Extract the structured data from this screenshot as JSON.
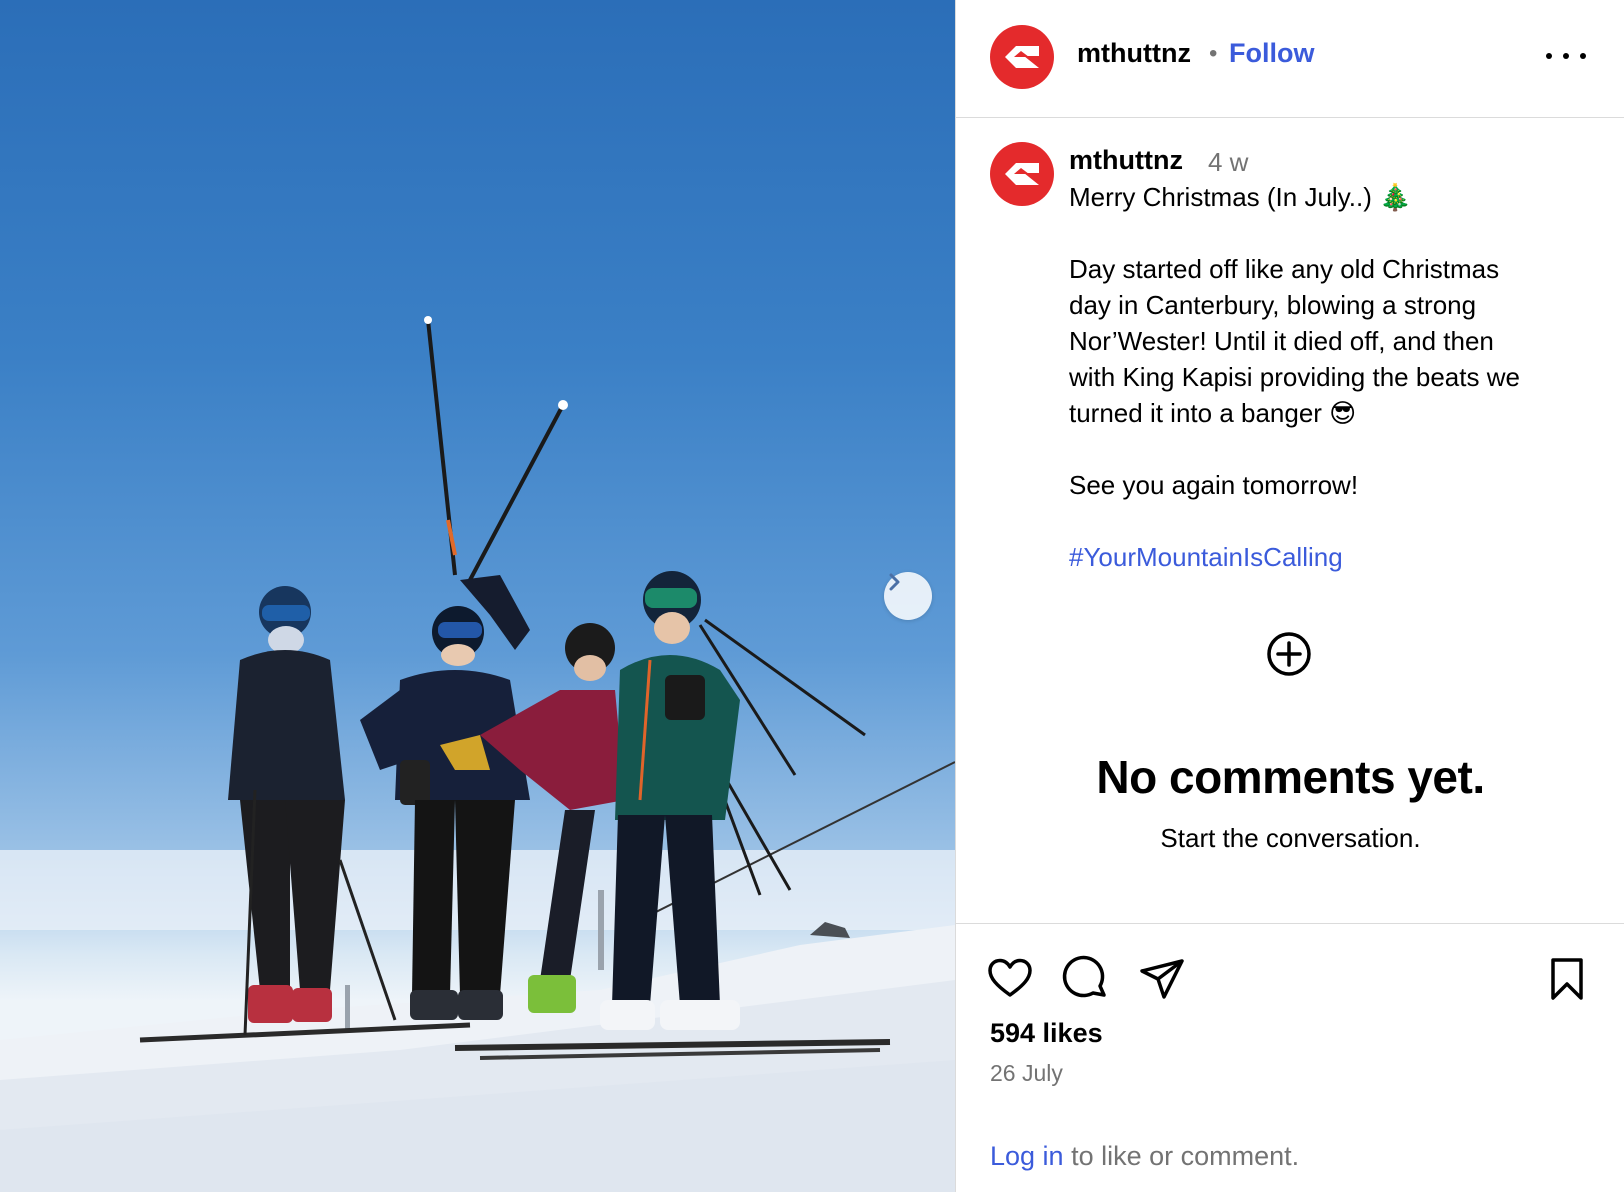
{
  "photo": {
    "alt_scene": "",
    "next_label": ""
  },
  "header": {
    "username": "mthuttnz",
    "separator": "•",
    "follow_label": "Follow"
  },
  "caption": {
    "username": "mthuttnz",
    "time_ago": "4 w",
    "line1": "Merry Christmas (In July..) 🎄",
    "para2_l1": "Day started off like any old Christmas",
    "para2_l2": "day in Canterbury, blowing a strong",
    "para2_l3": "Nor’Wester! Until it died off, and then",
    "para2_l4": "with King Kapisi providing the beats we",
    "para2_l5": "turned it into a banger 😎",
    "para3": "See you again tomorrow!",
    "hashtag": "#YourMountainIsCalling"
  },
  "comments": {
    "empty_title": "No comments yet.",
    "empty_subtitle": "Start the conversation."
  },
  "actions": {
    "likes": "594 likes",
    "date": "26 July",
    "login_link": "Log in",
    "login_rest": " to like or comment."
  },
  "colors": {
    "brand_red": "#e42a2c",
    "link_blue": "#3b5bdb",
    "muted": "#737373"
  }
}
